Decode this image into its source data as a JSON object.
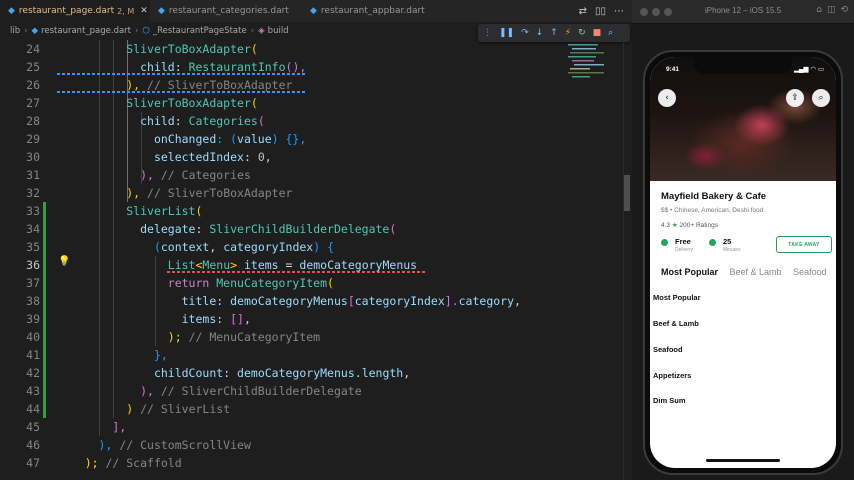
{
  "editor": {
    "tabs": [
      {
        "label": "restaurant_page.dart",
        "modified": "2, M",
        "active": true
      },
      {
        "label": "restaurant_categories.dart",
        "active": false
      },
      {
        "label": "restaurant_appbar.dart",
        "active": false
      }
    ],
    "breadcrumb": [
      "lib",
      "restaurant_page.dart",
      "_RestaurantPageState",
      "build"
    ],
    "current_line": 36,
    "line_numbers": [
      "24",
      "25",
      "26",
      "27",
      "28",
      "29",
      "30",
      "31",
      "32",
      "33",
      "34",
      "35",
      "36",
      "37",
      "38",
      "39",
      "40",
      "41",
      "42",
      "43",
      "44",
      "45",
      "46",
      "47"
    ],
    "code": {
      "l24": {
        "a": "SliverToBoxAdapter",
        "b": "("
      },
      "l25": {
        "a": "child",
        "b": ": ",
        "c": "RestaurantInfo",
        "d": "(),"
      },
      "l26": {
        "a": "), ",
        "b": "// SliverToBoxAdapter"
      },
      "l27": {
        "a": "SliverToBoxAdapter",
        "b": "("
      },
      "l28": {
        "a": "child",
        "b": ": ",
        "c": "Categories",
        "d": "("
      },
      "l29": {
        "a": "onChanged",
        "b": ": (",
        "c": "value",
        "d": ") {},"
      },
      "l30": {
        "a": "selectedIndex",
        "b": ": ",
        "c": "0",
        "d": ","
      },
      "l31": {
        "a": "), ",
        "b": "// Categories"
      },
      "l32": {
        "a": "), ",
        "b": "// SliverToBoxAdapter"
      },
      "l33": {
        "a": "SliverList",
        "b": "("
      },
      "l34": {
        "a": "delegate",
        "b": ": ",
        "c": "SliverChildBuilderDelegate",
        "d": "("
      },
      "l35": {
        "a": "(",
        "b": "context",
        "c": ", ",
        "d": "categoryIndex",
        "e": ") {"
      },
      "l36": {
        "a": "List",
        "b": "<",
        "c": "Menu",
        "d": "> ",
        "e": "items",
        "f": " = ",
        "g": "demoCategoryMenus"
      },
      "l37": {
        "a": "return ",
        "b": "MenuCategoryItem",
        "c": "("
      },
      "l38": {
        "a": "title",
        "b": ": ",
        "c": "demoCategoryMenus",
        "d": "[",
        "e": "categoryIndex",
        "f": "].",
        "g": "category",
        "h": ","
      },
      "l39": {
        "a": "items",
        "b": ": ",
        "c": "[]",
        "d": ","
      },
      "l40": {
        "a": "); ",
        "b": "// MenuCategoryItem"
      },
      "l41": {
        "a": "},"
      },
      "l42": {
        "a": "childCount",
        "b": ": ",
        "c": "demoCategoryMenus",
        "d": ".",
        "e": "length",
        "f": ","
      },
      "l43": {
        "a": "), ",
        "b": "// SliverChildBuilderDelegate"
      },
      "l44": {
        "a": ") ",
        "b": "// SliverList"
      },
      "l45": {
        "a": "],"
      },
      "l46": {
        "a": "), ",
        "b": "// CustomScrollView"
      },
      "l47": {
        "a": "); ",
        "b": "// Scaffold"
      }
    }
  },
  "simulator": {
    "title": "iPhone 12 – iOS 15.5",
    "status_time": "9:41",
    "restaurant": {
      "name": "Mayfield Bakery & Cafe",
      "price_level": "$$",
      "cuisine": "Chinese, American, Deshi food",
      "rating": "4.3",
      "ratings_count": "200+ Ratings",
      "delivery_fee": "Free",
      "delivery_fee_label": "Delivery",
      "delivery_time": "25",
      "delivery_time_label": "Minutes",
      "take_away_label": "TAKE AWAY"
    },
    "categories": [
      "Most Popular",
      "Beef & Lamb",
      "Seafood"
    ],
    "menu_items": [
      "Most Popular",
      "Beef & Lamb",
      "Seafood",
      "Appetizers",
      "Dim Sum"
    ],
    "colors": {
      "accent": "#22a45d"
    }
  }
}
